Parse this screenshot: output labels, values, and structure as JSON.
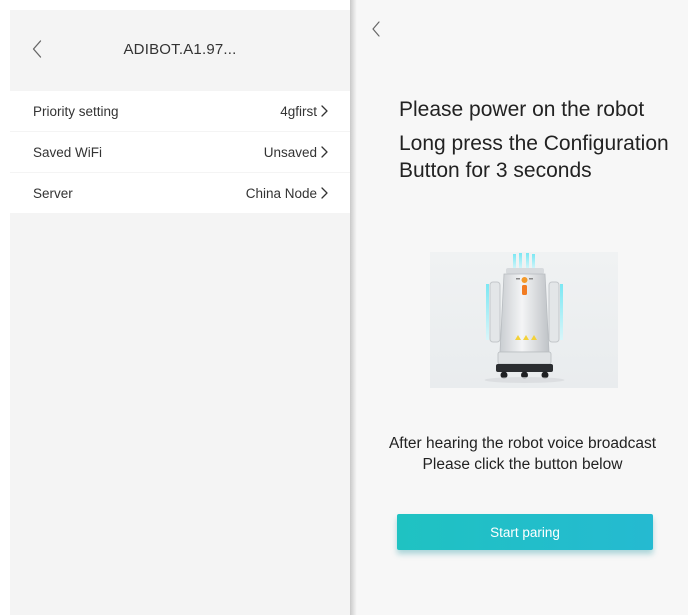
{
  "left_screen": {
    "title": "ADIBOT.A1.97...",
    "back_icon": "chevron-left-icon",
    "settings": [
      {
        "label": "Priority setting",
        "value": "4gfirst"
      },
      {
        "label": "Saved WiFi",
        "value": "Unsaved"
      },
      {
        "label": "Server",
        "value": "China Node"
      }
    ],
    "row_chevron_icon": "chevron-right-icon"
  },
  "right_screen": {
    "back_icon": "chevron-left-icon",
    "instruction_line1": "Please power on the robot",
    "instruction_line2": "Long press the Configuration Button for 3 seconds",
    "robot_image_icon": "robot-image",
    "hint_line1": "After hearing the robot voice broadcast",
    "hint_line2": "Please click the button below",
    "button_label": "Start paring"
  },
  "colors": {
    "accent": "#22bfc9",
    "background_left": "#f4f4f4",
    "background_right": "#f7f7f7",
    "text": "#222222"
  }
}
